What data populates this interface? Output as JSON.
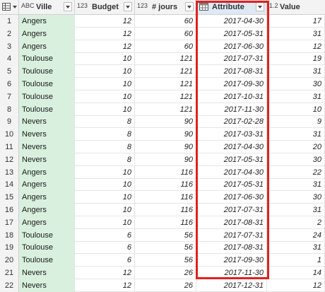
{
  "colors": {
    "selected_column_header_bg": "#dfe9f3",
    "highlight_border": "#e02020",
    "ville_col_bg": "#d9f0de"
  },
  "header": {
    "table_menu_icon": "table-grid-icon",
    "columns": [
      {
        "type_label": "ABC",
        "name": "Ville"
      },
      {
        "type_label": "123",
        "name": "Budget"
      },
      {
        "type_label": "123",
        "name": "# jours"
      },
      {
        "type_label": "calendar",
        "name": "Attribute"
      },
      {
        "type_label": "1.2",
        "name": "Value"
      }
    ]
  },
  "rows": [
    {
      "n": "1",
      "ville": "Angers",
      "budget": "12",
      "jours": "60",
      "attribute": "2017-04-30",
      "value": "17"
    },
    {
      "n": "2",
      "ville": "Angers",
      "budget": "12",
      "jours": "60",
      "attribute": "2017-05-31",
      "value": "31"
    },
    {
      "n": "3",
      "ville": "Angers",
      "budget": "12",
      "jours": "60",
      "attribute": "2017-06-30",
      "value": "12"
    },
    {
      "n": "4",
      "ville": "Toulouse",
      "budget": "10",
      "jours": "121",
      "attribute": "2017-07-31",
      "value": "19"
    },
    {
      "n": "5",
      "ville": "Toulouse",
      "budget": "10",
      "jours": "121",
      "attribute": "2017-08-31",
      "value": "31"
    },
    {
      "n": "6",
      "ville": "Toulouse",
      "budget": "10",
      "jours": "121",
      "attribute": "2017-09-30",
      "value": "30"
    },
    {
      "n": "7",
      "ville": "Toulouse",
      "budget": "10",
      "jours": "121",
      "attribute": "2017-10-31",
      "value": "31"
    },
    {
      "n": "8",
      "ville": "Toulouse",
      "budget": "10",
      "jours": "121",
      "attribute": "2017-11-30",
      "value": "10"
    },
    {
      "n": "9",
      "ville": "Nevers",
      "budget": "8",
      "jours": "90",
      "attribute": "2017-02-28",
      "value": "9"
    },
    {
      "n": "10",
      "ville": "Nevers",
      "budget": "8",
      "jours": "90",
      "attribute": "2017-03-31",
      "value": "31"
    },
    {
      "n": "11",
      "ville": "Nevers",
      "budget": "8",
      "jours": "90",
      "attribute": "2017-04-30",
      "value": "20"
    },
    {
      "n": "12",
      "ville": "Nevers",
      "budget": "8",
      "jours": "90",
      "attribute": "2017-05-31",
      "value": "30"
    },
    {
      "n": "13",
      "ville": "Angers",
      "budget": "10",
      "jours": "116",
      "attribute": "2017-04-30",
      "value": "22"
    },
    {
      "n": "14",
      "ville": "Angers",
      "budget": "10",
      "jours": "116",
      "attribute": "2017-05-31",
      "value": "31"
    },
    {
      "n": "15",
      "ville": "Angers",
      "budget": "10",
      "jours": "116",
      "attribute": "2017-06-30",
      "value": "30"
    },
    {
      "n": "16",
      "ville": "Angers",
      "budget": "10",
      "jours": "116",
      "attribute": "2017-07-31",
      "value": "31"
    },
    {
      "n": "17",
      "ville": "Angers",
      "budget": "10",
      "jours": "116",
      "attribute": "2017-08-31",
      "value": "2"
    },
    {
      "n": "18",
      "ville": "Toulouse",
      "budget": "6",
      "jours": "56",
      "attribute": "2017-07-31",
      "value": "24"
    },
    {
      "n": "19",
      "ville": "Toulouse",
      "budget": "6",
      "jours": "56",
      "attribute": "2017-08-31",
      "value": "31"
    },
    {
      "n": "20",
      "ville": "Toulouse",
      "budget": "6",
      "jours": "56",
      "attribute": "2017-09-30",
      "value": "1"
    },
    {
      "n": "21",
      "ville": "Nevers",
      "budget": "12",
      "jours": "26",
      "attribute": "2017-11-30",
      "value": "14"
    },
    {
      "n": "22",
      "ville": "Nevers",
      "budget": "12",
      "jours": "26",
      "attribute": "2017-12-31",
      "value": "12"
    }
  ]
}
